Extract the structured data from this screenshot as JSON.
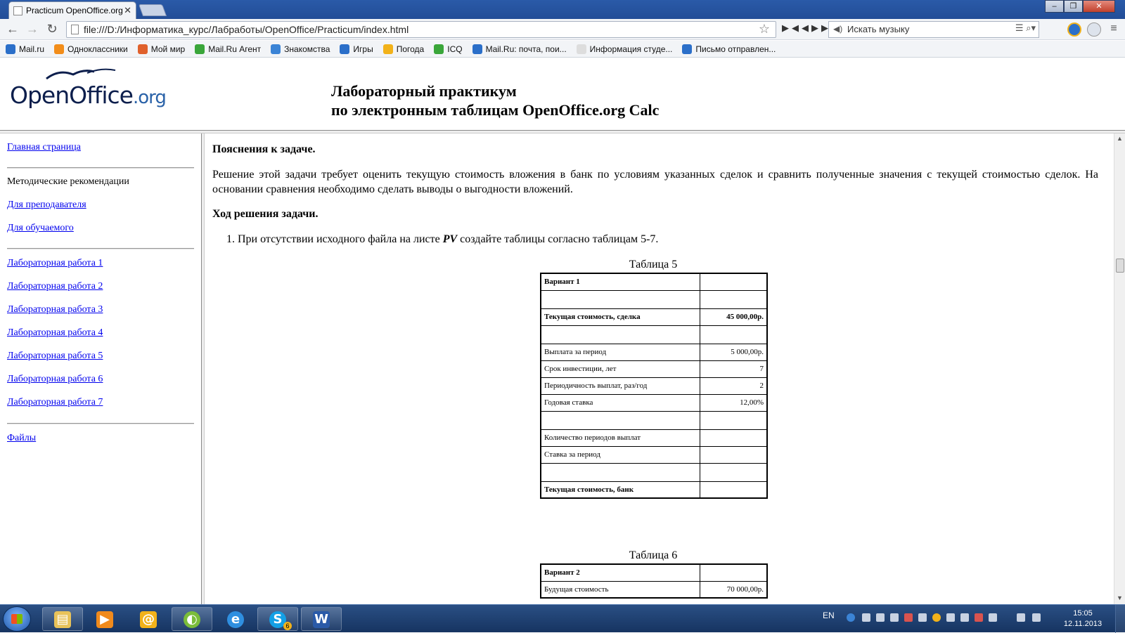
{
  "browser": {
    "tab_title": "Practicum OpenOffice.org",
    "url": "file:///D:/Информатика_курс/Лабработы/OpenOffice/Practicum/index.html",
    "music_search_placeholder": "Искать музыку"
  },
  "bookmarks": [
    {
      "label": "Mail.ru",
      "color": "#2b6fc9"
    },
    {
      "label": "Одноклассники",
      "color": "#f28d1a"
    },
    {
      "label": "Мой мир",
      "color": "#e0612c"
    },
    {
      "label": "Mail.Ru Агент",
      "color": "#3aa63a"
    },
    {
      "label": "Знакомства",
      "color": "#3b84d6"
    },
    {
      "label": "Игры",
      "color": "#2b6fc9"
    },
    {
      "label": "Погода",
      "color": "#f2b21a"
    },
    {
      "label": "ICQ",
      "color": "#3aa63a"
    },
    {
      "label": "Mail.Ru: почта, пои...",
      "color": "#2b6fc9"
    },
    {
      "label": "Информация студе...",
      "color": "#dddddd"
    },
    {
      "label": "Письмо отправлен...",
      "color": "#2b6fc9"
    }
  ],
  "header": {
    "logo_main": "OpenOffice",
    "logo_suffix": ".org",
    "title_line1": "Лабораторный практикум",
    "title_line2": "по электронным таблицам OpenOffice.org Calc"
  },
  "sidebar": {
    "home": "Главная страница",
    "methodical": "Методические рекомендации",
    "for_teacher": "Для преподавателя",
    "for_student": "Для обучаемого",
    "labs": [
      "Лабораторная работа 1",
      "Лабораторная работа 2",
      "Лабораторная работа 3",
      "Лабораторная работа 4",
      "Лабораторная работа 5",
      "Лабораторная работа 6",
      "Лабораторная работа 7"
    ],
    "files": "Файлы"
  },
  "content": {
    "heading1": "Пояснения к задаче.",
    "paragraph1": "Решение этой задачи требует оценить текущую стоимость вложения в банк по условиям указанных сделок и сравнить полученные значения с текущей стоимостью сделок. На основании сравнения необходимо сделать выводы о выгодности вложений.",
    "heading2": "Ход решения задачи.",
    "step1_prefix": "1.  При отсутствии исходного файла на листе ",
    "step1_sheet": "PV",
    "step1_suffix": " создайте таблицы согласно таблицам 5-7.",
    "table5": {
      "caption": "Таблица 5",
      "rows": [
        {
          "label": "Вариант 1",
          "value": ""
        },
        {
          "label": "",
          "value": ""
        },
        {
          "label": "Текущая стоимость, сделка",
          "value": "45 000,00р."
        },
        {
          "label": "",
          "value": ""
        },
        {
          "label": "Выплата за период",
          "value": "5 000,00р."
        },
        {
          "label": "Срок инвестиции, лет",
          "value": "7"
        },
        {
          "label": "Периодичность выплат, раз/год",
          "value": "2"
        },
        {
          "label": "Годовая ставка",
          "value": "12,00%"
        },
        {
          "label": "",
          "value": ""
        },
        {
          "label": "Количество периодов выплат",
          "value": ""
        },
        {
          "label": "Ставка за период",
          "value": ""
        },
        {
          "label": "",
          "value": ""
        },
        {
          "label": "Текущая стоимость, банк",
          "value": ""
        }
      ]
    },
    "table6": {
      "caption": "Таблица 6",
      "rows": [
        {
          "label": "Вариант 2",
          "value": ""
        },
        {
          "label": "Будущая стоимость",
          "value": "70 000,00р."
        }
      ]
    }
  },
  "taskbar": {
    "language": "EN",
    "time": "15:05",
    "date": "12.11.2013",
    "skype_badge": "6"
  }
}
